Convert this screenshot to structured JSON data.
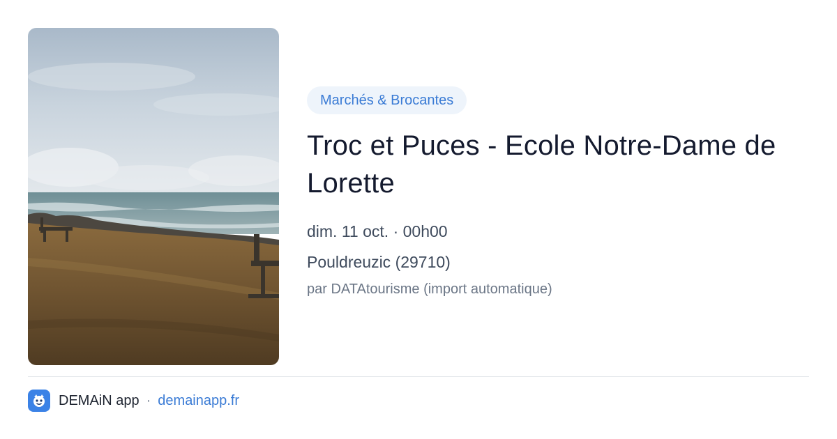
{
  "event": {
    "category": "Marchés & Brocantes",
    "title": "Troc et Puces - Ecole Notre-Dame de Lorette",
    "date": "dim. 11 oct. · 00h00",
    "location": "Pouldreuzic (29710)",
    "source": "par DATAtourisme (import automatique)"
  },
  "footer": {
    "app_name": "DEMAiN app",
    "separator": "·",
    "site": "demainapp.fr"
  },
  "icons": {
    "app": "demain-app-icon"
  },
  "colors": {
    "accent": "#3a7bd5",
    "badge_bg": "#eef4fb",
    "title": "#141a2e",
    "app_icon_bg": "#3b82e6"
  }
}
